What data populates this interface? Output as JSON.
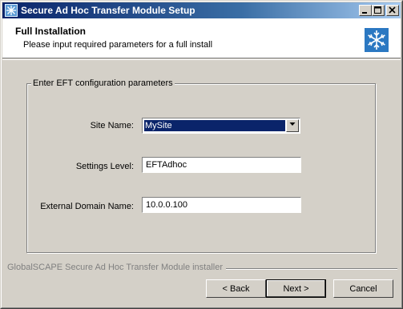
{
  "window": {
    "title": "Secure Ad Hoc Transfer Module Setup"
  },
  "header": {
    "title": "Full Installation",
    "subtitle": "Please input required parameters for a full install"
  },
  "group": {
    "legend": "Enter EFT configuration parameters",
    "site_name": {
      "label": "Site Name:",
      "value": "MySite"
    },
    "settings_level": {
      "label": "Settings Level:",
      "value": "EFTAdhoc"
    },
    "external_domain": {
      "label": "External Domain Name:",
      "value": "10.0.0.100"
    }
  },
  "footer": {
    "installer_label": "GlobalSCAPE Secure Ad Hoc Transfer Module installer",
    "back_label": "< Back",
    "next_label": "Next >",
    "cancel_label": "Cancel"
  },
  "colors": {
    "titlebar": "#0a246a",
    "selection": "#0a246a",
    "dialog": "#d4d0c8"
  },
  "icons": [
    "setup-app-icon",
    "minimize-icon",
    "maximize-icon",
    "close-icon",
    "snowflake-logo-icon",
    "dropdown-arrow-icon"
  ]
}
